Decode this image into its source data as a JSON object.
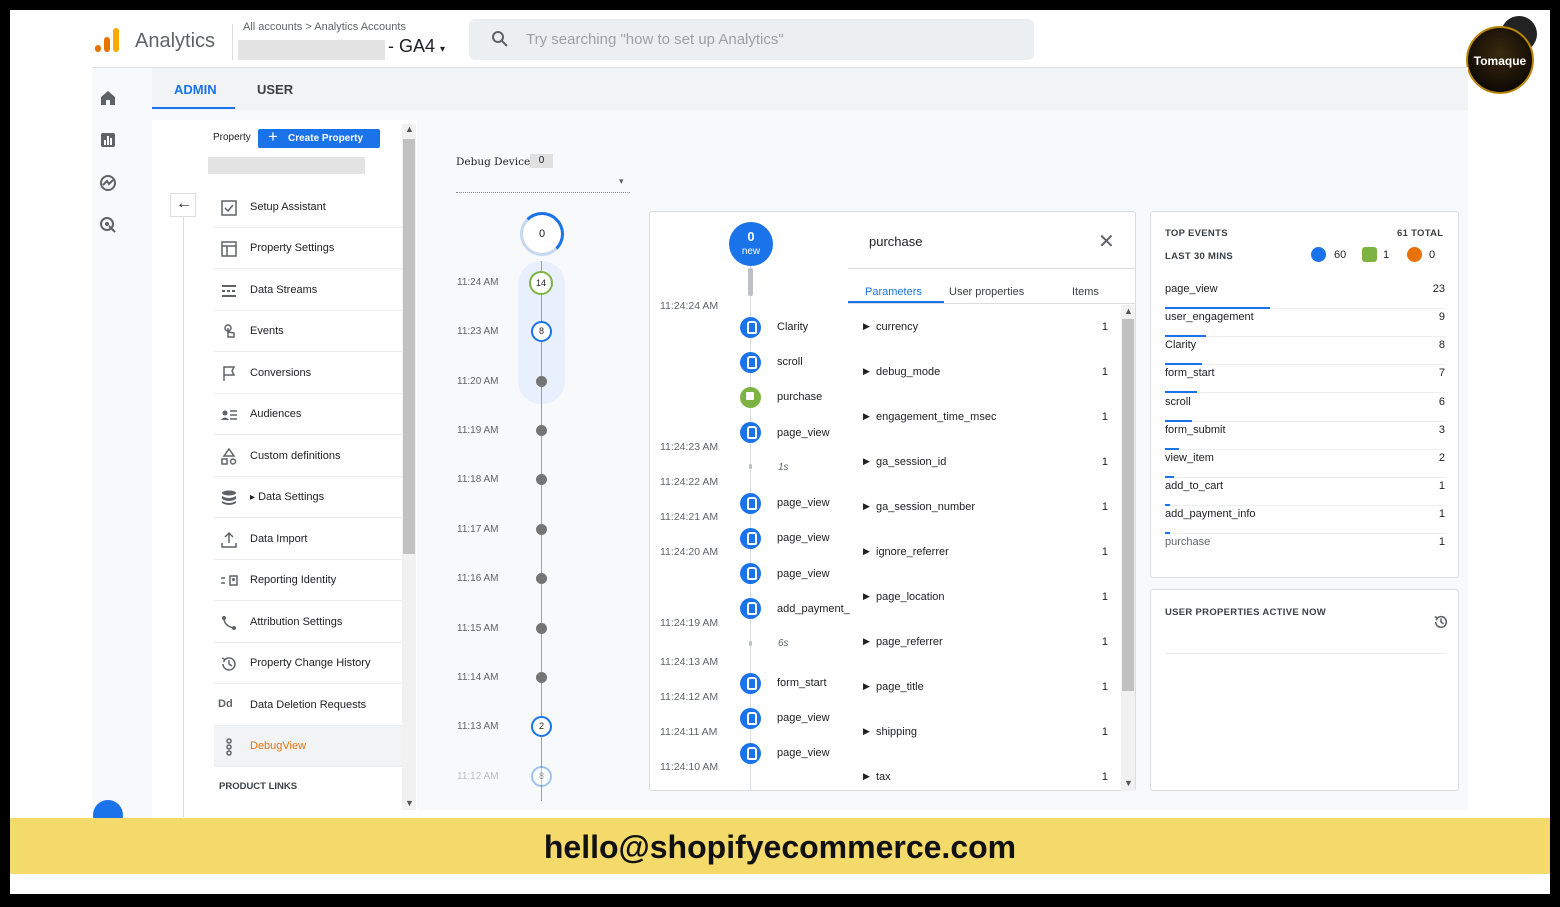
{
  "header": {
    "app_title": "Analytics",
    "breadcrumb": "All accounts > Analytics Accounts",
    "property_name": "- GA4",
    "property_caret": "▾",
    "search_placeholder": "Try searching \"how to set up Analytics\"",
    "brand": "Tomaque"
  },
  "tabs": [
    {
      "label": "ADMIN",
      "active": true
    },
    {
      "label": "USER",
      "active": false
    }
  ],
  "admin_nav": {
    "property_label": "Property",
    "create_button": "Create Property",
    "create_icon": "+",
    "back_icon": "←",
    "items": [
      {
        "label": "Setup Assistant",
        "icon": "checkbox-icon"
      },
      {
        "label": "Property Settings",
        "icon": "settings-panel-icon"
      },
      {
        "label": "Data Streams",
        "icon": "streams-icon"
      },
      {
        "label": "Events",
        "icon": "touch-icon"
      },
      {
        "label": "Conversions",
        "icon": "flag-icon"
      },
      {
        "label": "Audiences",
        "icon": "audience-icon"
      },
      {
        "label": "Custom definitions",
        "icon": "shapes-icon"
      },
      {
        "label": "Data Settings",
        "icon": "database-icon",
        "expander": "▸"
      },
      {
        "label": "Data Import",
        "icon": "upload-icon"
      },
      {
        "label": "Reporting Identity",
        "icon": "identity-icon"
      },
      {
        "label": "Attribution Settings",
        "icon": "attribution-icon"
      },
      {
        "label": "Property Change History",
        "icon": "history-icon"
      },
      {
        "label": "Data Deletion Requests",
        "icon": "dd-icon",
        "glyph": "Dd"
      },
      {
        "label": "DebugView",
        "icon": "debug-icon",
        "active": true
      }
    ],
    "product_links": "PRODUCT LINKS"
  },
  "debug_device": {
    "label": "Debug Device",
    "count": "0",
    "caret": "▾"
  },
  "minutes_timeline": {
    "top_count": "0",
    "rows": [
      {
        "time": "11:24 AM",
        "count": "14"
      },
      {
        "time": "11:23 AM",
        "count": "8"
      },
      {
        "time": "11:20 AM",
        "count": null
      },
      {
        "time": "11:19 AM",
        "count": null
      },
      {
        "time": "11:18 AM",
        "count": null
      },
      {
        "time": "11:17 AM",
        "count": null
      },
      {
        "time": "11:16 AM",
        "count": null
      },
      {
        "time": "11:15 AM",
        "count": null
      },
      {
        "time": "11:14 AM",
        "count": null
      },
      {
        "time": "11:13 AM",
        "count": "2"
      },
      {
        "time": "11:12 AM",
        "count": "8"
      }
    ]
  },
  "seconds_stream": {
    "top_count": "0",
    "top_label": "new",
    "times": [
      "11:24:24 AM",
      "11:24:23 AM",
      "11:24:22 AM",
      "11:24:21 AM",
      "11:24:20 AM",
      "11:24:19 AM",
      "11:24:13 AM",
      "11:24:12 AM",
      "11:24:11 AM",
      "11:24:10 AM"
    ],
    "events": [
      {
        "name": "Clarity",
        "type": "event"
      },
      {
        "name": "scroll",
        "type": "event"
      },
      {
        "name": "purchase",
        "type": "conversion"
      },
      {
        "name": "page_view",
        "type": "event"
      },
      {
        "name": "page_view",
        "type": "event"
      },
      {
        "name": "page_view",
        "type": "event"
      },
      {
        "name": "page_view",
        "type": "event"
      },
      {
        "name": "add_payment_",
        "type": "event"
      },
      {
        "name": "form_start",
        "type": "event"
      },
      {
        "name": "page_view",
        "type": "event"
      },
      {
        "name": "page_view",
        "type": "event"
      }
    ],
    "gaps": [
      "1s",
      "6s"
    ]
  },
  "event_detail": {
    "title": "purchase",
    "close_icon": "✕",
    "tabs": [
      "Parameters",
      "User properties",
      "Items"
    ],
    "params": [
      {
        "name": "currency",
        "count": "1"
      },
      {
        "name": "debug_mode",
        "count": "1"
      },
      {
        "name": "engagement_time_msec",
        "count": "1"
      },
      {
        "name": "ga_session_id",
        "count": "1"
      },
      {
        "name": "ga_session_number",
        "count": "1"
      },
      {
        "name": "ignore_referrer",
        "count": "1"
      },
      {
        "name": "page_location",
        "count": "1"
      },
      {
        "name": "page_referrer",
        "count": "1"
      },
      {
        "name": "page_title",
        "count": "1"
      },
      {
        "name": "shipping",
        "count": "1"
      },
      {
        "name": "tax",
        "count": "1"
      }
    ]
  },
  "top_events": {
    "title": "TOP EVENTS",
    "total": "61 TOTAL",
    "range": "LAST 30 MINS",
    "counts": {
      "events": "60",
      "conversions": "1",
      "errors": "0"
    },
    "rows": [
      {
        "name": "page_view",
        "value": "23"
      },
      {
        "name": "user_engagement",
        "value": "9"
      },
      {
        "name": "Clarity",
        "value": "8"
      },
      {
        "name": "form_start",
        "value": "7"
      },
      {
        "name": "scroll",
        "value": "6"
      },
      {
        "name": "form_submit",
        "value": "3"
      },
      {
        "name": "view_item",
        "value": "2"
      },
      {
        "name": "add_to_cart",
        "value": "1"
      },
      {
        "name": "add_payment_info",
        "value": "1"
      },
      {
        "name": "purchase",
        "value": "1"
      }
    ]
  },
  "user_properties": {
    "title": "USER PROPERTIES ACTIVE NOW",
    "history_icon": "history-icon"
  },
  "banner": {
    "text": "hello@shopifyecommerce.com"
  },
  "colors": {
    "accent": "#1a73e8",
    "conversion": "#7cb342",
    "error": "#e8710a",
    "banner": "#f4d96b"
  }
}
